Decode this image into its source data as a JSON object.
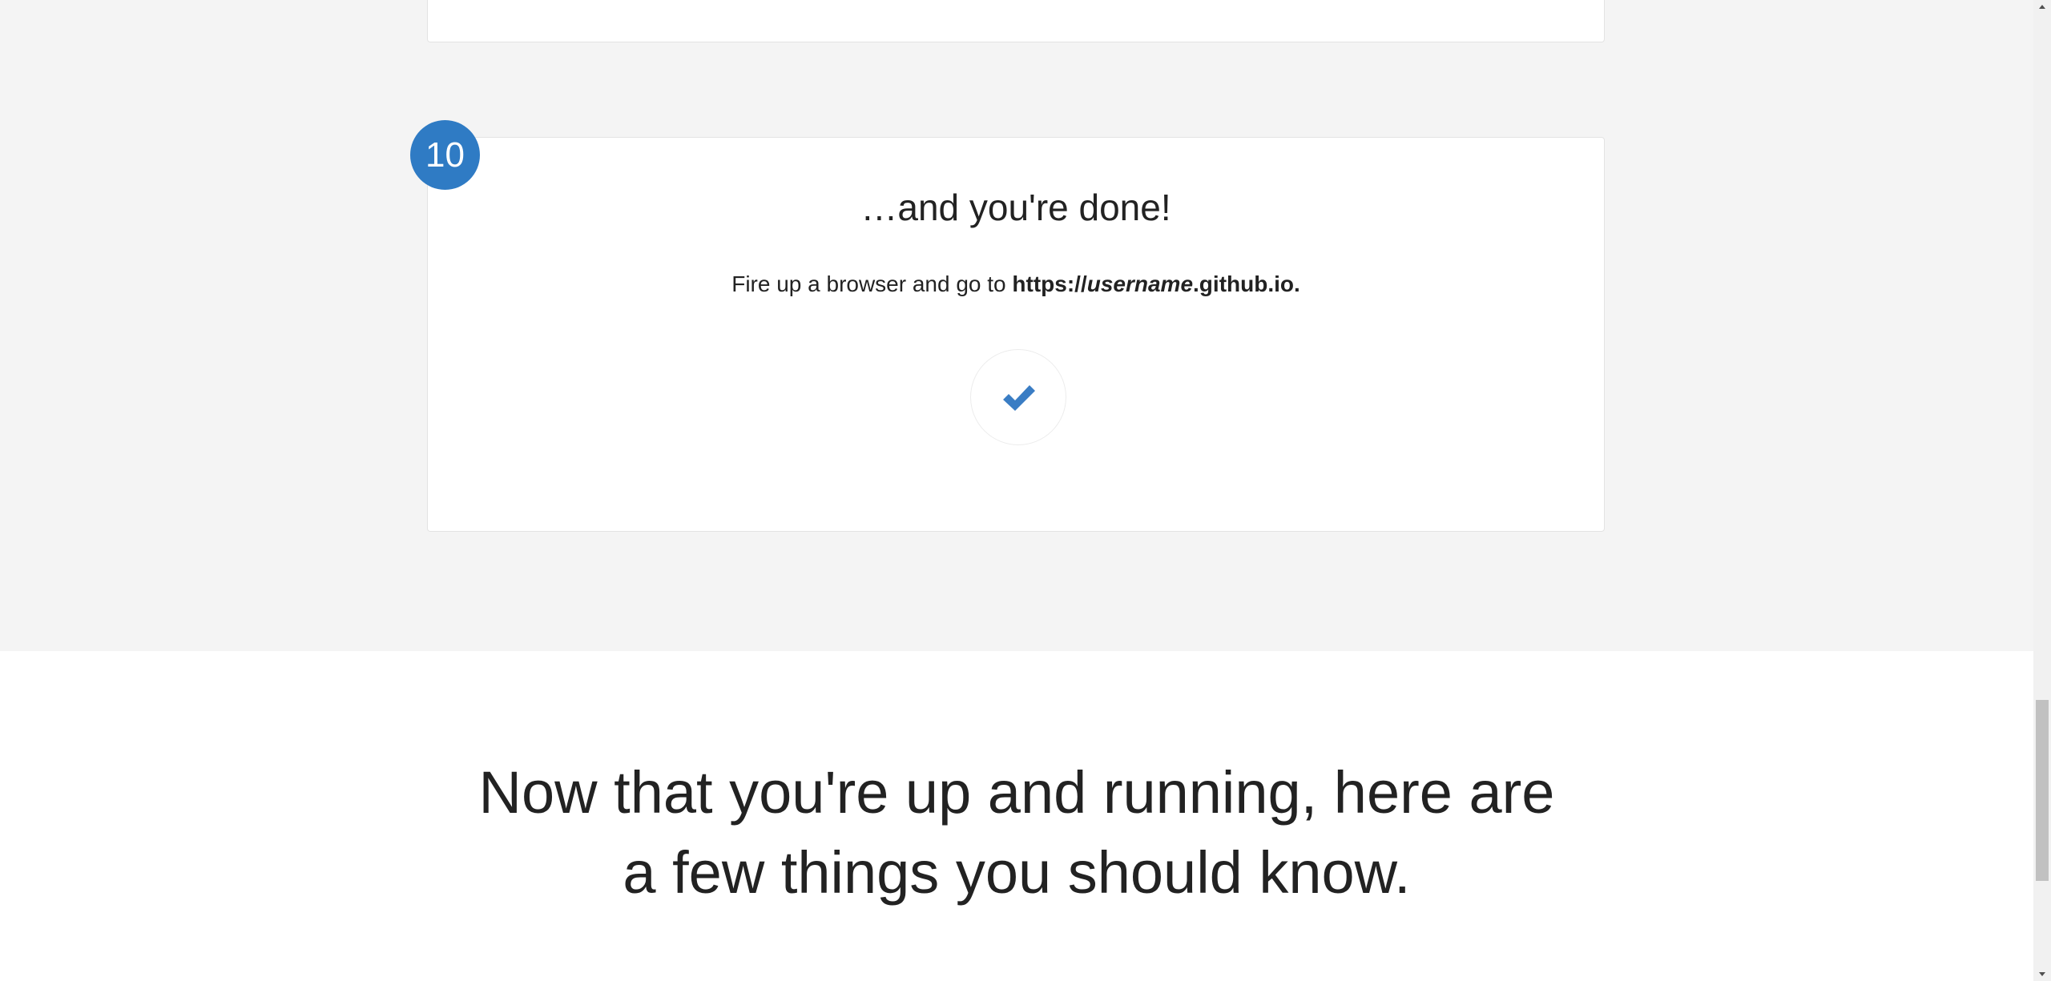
{
  "step": {
    "number": "10",
    "title": "…and you're done!",
    "text_prefix": "Fire up a browser and go to ",
    "url_prefix": "https://",
    "url_user": "username",
    "url_suffix": ".github.io.",
    "icon": "check-icon"
  },
  "section": {
    "heading_line1": "Now that you're up and running, here are",
    "heading_line2": "a few things you should know."
  },
  "colors": {
    "accent": "#2f7bc4",
    "check": "#3a7dc4",
    "gray_bg": "#f4f4f4"
  }
}
